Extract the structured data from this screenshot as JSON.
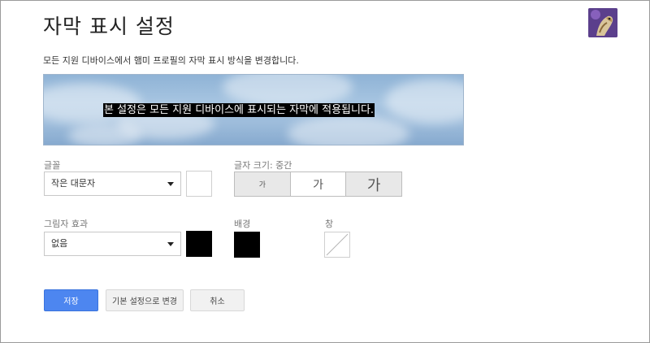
{
  "page": {
    "title": "자막 표시 설정",
    "description": "모든 지원 디바이스에서 햄미 프로필의 자막 표시 방식을 변경합니다."
  },
  "preview": {
    "caption": "본 설정은 모든 지원 디바이스에 표시되는 자막에 적용됩니다."
  },
  "font": {
    "label": "글꼴",
    "selected": "작은 대문자",
    "color": "#ffffff"
  },
  "font_size": {
    "label": "글자 크기: 중간",
    "options": [
      "가",
      "가",
      "가"
    ],
    "selected_index": 1
  },
  "shadow": {
    "label": "그림자 효과",
    "selected": "없음",
    "color": "#000000"
  },
  "background": {
    "label": "배경",
    "color": "#000000"
  },
  "window": {
    "label": "창",
    "color": "none"
  },
  "buttons": {
    "save": "저장",
    "reset": "기본 설정으로 변경",
    "cancel": "취소"
  },
  "colors": {
    "accent": "#4d86f0"
  }
}
